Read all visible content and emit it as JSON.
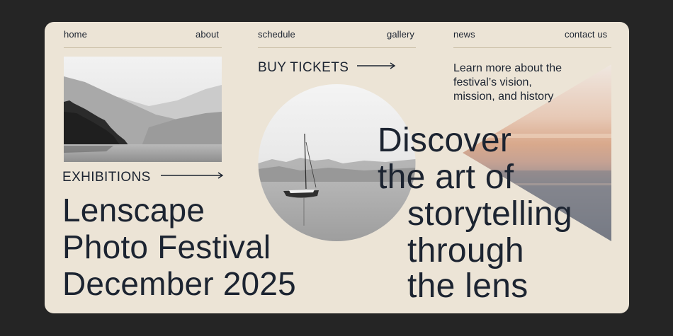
{
  "nav": {
    "items": [
      {
        "label": "home"
      },
      {
        "label": "about"
      },
      {
        "label": "schedule"
      },
      {
        "label": "gallery"
      },
      {
        "label": "news"
      },
      {
        "label": "contact us"
      }
    ]
  },
  "exhibitions": {
    "label": "EXHIBITIONS"
  },
  "tickets": {
    "label": "BUY TICKETS"
  },
  "about_blurb": {
    "text": "Learn more about the festival’s vision, mission, and history"
  },
  "hero": {
    "title_lines": [
      "Lenscape",
      "Photo Festival",
      "December 2025"
    ],
    "tagline_lines": [
      "Discover",
      "the art of",
      "storytelling",
      "through",
      "the lens"
    ]
  },
  "colors": {
    "background": "#252525",
    "card": "#ece4d6",
    "text": "#1c2431",
    "rule": "#c9bca4"
  }
}
